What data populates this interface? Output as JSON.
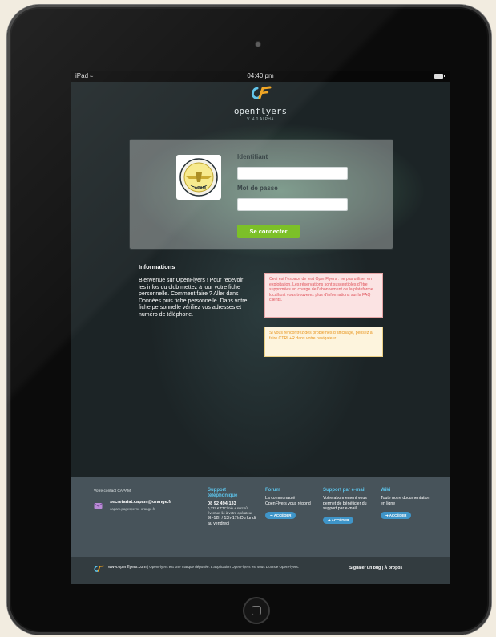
{
  "status_bar": {
    "carrier": "iPad",
    "time": "04:40 pm",
    "icons": [
      "wifi-icon",
      "battery-icon"
    ]
  },
  "logo": {
    "name": "openflyers",
    "version": "V. 4.0 ALPHA"
  },
  "login": {
    "club_logo_text": "CAPAM",
    "identifiant_label": "Identifiant",
    "identifiant_value": "",
    "password_label": "Mot de passe",
    "password_value": "",
    "submit_label": "Se connecter"
  },
  "informations": {
    "title": "Informations",
    "text": "Bienvenue sur OpenFlyers ! Pour recevoir les infos du club mettez à jour votre fiche personnelle. Comment faire ? Aller dans Données puis fiche personnelle. Dans votre fiche personnelle vérifiez vos adresses et numéro de téléphone."
  },
  "alerts": {
    "warning": "Ceci est l'espace de test OpenFlyers : ne pas utiliser en exploitation. Les réservations sont susceptibles d'être supprimées en charge de l'abonnement de la plateforme localhost vous trouverez plus d'informations sur la FAQ clients.",
    "tip": "Si vous rencontrez des problèmes d'affichage, pensez à faire CTRL+R dans votre navigateur."
  },
  "footer": {
    "contact": {
      "heading": "Votre contact CAPAM",
      "email": "secretariat.capam@orange.fr",
      "site": "capam.pagesperso-orange.fr"
    },
    "phone_support": {
      "title": "Support téléphonique",
      "number": "08 92 494 133",
      "rate": "0,337 € TTC/min + surcoût éventuel lié à votre opérateur",
      "hours": "9h-12h / 13h-17h Du lundi au vendredi"
    },
    "forum": {
      "title": "Forum",
      "text": "La communauté OpenFlyers vous répond",
      "button": "ACCÉDER"
    },
    "email_support": {
      "title": "Support par e-mail",
      "text": "Votre abonnement vous permet de bénéficier du support par e-mail",
      "button": "ACCÉDER"
    },
    "wiki": {
      "title": "Wiki",
      "text": "Toute notre documentation en ligne",
      "button": "ACCÉDER"
    },
    "bottom": {
      "site": "www.openflyers.com",
      "legal": "| OpenFlyers est une marque déposée. L'application OpenFlyers est sous Licence OpenFlyers.",
      "links": "Signaler un bug | À propos"
    }
  },
  "colors": {
    "accent_green": "#7cc028",
    "link_blue": "#5cc3ea",
    "button_blue": "#3f95c9",
    "alert_red": "#e0535b",
    "alert_orange": "#e8951e"
  }
}
